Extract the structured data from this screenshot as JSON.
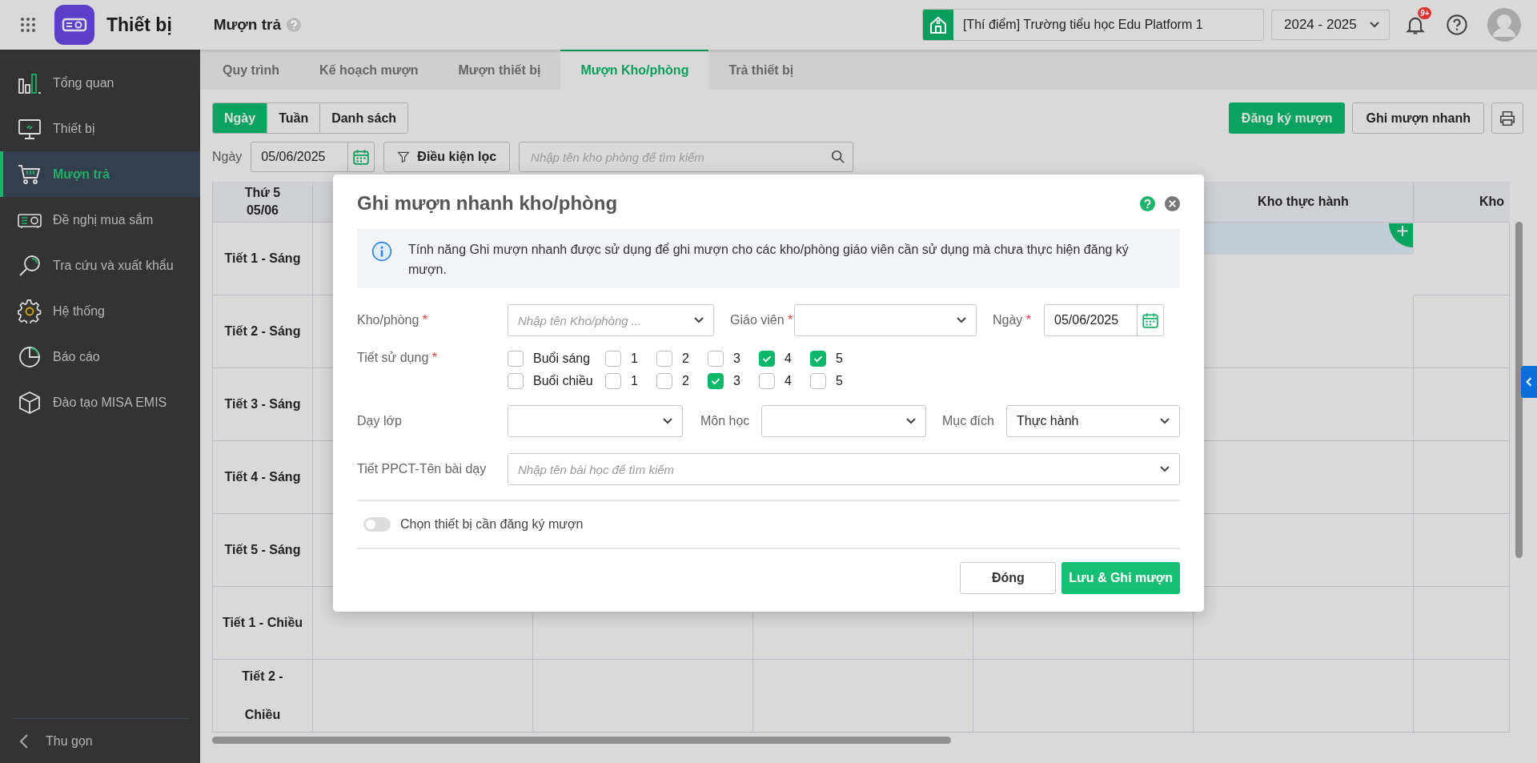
{
  "app": {
    "title": "Thiết bị",
    "page_title": "Mượn trả"
  },
  "header": {
    "school": "[Thí điểm] Trường tiểu học Edu Platform 1",
    "year": "2024 - 2025",
    "notification_badge": "9+"
  },
  "sidebar": {
    "items": [
      {
        "label": "Tổng quan",
        "selected": false
      },
      {
        "label": "Thiết bị",
        "selected": false
      },
      {
        "label": "Mượn trả",
        "selected": true
      },
      {
        "label": "Đề nghị mua sắm",
        "selected": false
      },
      {
        "label": "Tra cứu và xuất khẩu",
        "selected": false
      },
      {
        "label": "Hệ thống",
        "selected": false
      },
      {
        "label": "Báo cáo",
        "selected": false
      },
      {
        "label": "Đào tạo MISA EMIS",
        "selected": false
      }
    ],
    "collapse": "Thu gọn"
  },
  "tabs": [
    {
      "label": "Quy trình",
      "selected": false
    },
    {
      "label": "Kế hoạch mượn",
      "selected": false
    },
    {
      "label": "Mượn thiết bị",
      "selected": false
    },
    {
      "label": "Mượn Kho/phòng",
      "selected": true
    },
    {
      "label": "Trả thiết bị",
      "selected": false
    }
  ],
  "view_modes": [
    {
      "label": "Ngày",
      "selected": true
    },
    {
      "label": "Tuần",
      "selected": false
    },
    {
      "label": "Danh sách",
      "selected": false
    }
  ],
  "actions": {
    "register": "Đăng ký mượn",
    "quick": "Ghi mượn nhanh"
  },
  "filter": {
    "date_label": "Ngày",
    "date": "05/06/2025",
    "filter_button": "Điều kiện lọc",
    "search_placeholder": "Nhập tên kho phòng để tìm kiếm"
  },
  "table": {
    "day_header": "Thứ 5\n05/06",
    "columns": [
      {
        "label": "Kho thực hành"
      },
      {
        "label": "Kho"
      }
    ],
    "rows": [
      {
        "label": "Tiết 1 - Sáng",
        "cells": [
          {
            "selected": true
          },
          {
            "selected": false
          }
        ]
      },
      {
        "label": "Tiết 2 - Sáng",
        "cells": [
          {
            "selected": false
          },
          {
            "selected": false
          }
        ]
      },
      {
        "label": "Tiết 3 - Sáng",
        "cells": [
          {
            "selected": false
          },
          {
            "selected": false
          }
        ]
      },
      {
        "label": "Tiết 4 - Sáng",
        "cells": [
          {
            "selected": false
          },
          {
            "selected": false
          }
        ]
      },
      {
        "label": "Tiết 5 - Sáng",
        "cells": [
          {
            "selected": false
          },
          {
            "selected": false
          }
        ]
      },
      {
        "label": "Tiết 1 - Chiều",
        "cells": [
          {
            "selected": false
          },
          {
            "selected": false
          }
        ]
      },
      {
        "label": "Tiết 2 -\nChiều",
        "cells": [
          {
            "selected": false
          },
          {
            "selected": false
          }
        ]
      }
    ]
  },
  "dialog": {
    "title": "Ghi mượn nhanh kho/phòng",
    "info": "Tính năng Ghi mượn nhanh được sử dụng để ghi mượn cho các kho/phòng giáo viên cần sử dụng mà chưa thực hiện đăng ký mượn.",
    "room": {
      "label": "Kho/phòng",
      "mark": "*",
      "placeholder": "Nhập tên Kho/phòng ..."
    },
    "teacher": {
      "label": "Giáo viên",
      "mark": "*"
    },
    "date": {
      "label": "Ngày",
      "mark": "*",
      "value": "05/06/2025"
    },
    "periods": {
      "label": "Tiết sử dụng",
      "mark": "*",
      "sessions": [
        {
          "label": "Buổi sáng",
          "checked": false,
          "periods": [
            {
              "label": "1",
              "checked": false
            },
            {
              "label": "2",
              "checked": false
            },
            {
              "label": "3",
              "checked": false
            },
            {
              "label": "4",
              "checked": true
            },
            {
              "label": "5",
              "checked": true
            }
          ]
        },
        {
          "label": "Buổi chiều",
          "checked": false,
          "periods": [
            {
              "label": "1",
              "checked": false
            },
            {
              "label": "2",
              "checked": false
            },
            {
              "label": "3",
              "checked": true
            },
            {
              "label": "4",
              "checked": false
            },
            {
              "label": "5",
              "checked": false
            }
          ]
        }
      ]
    },
    "class": {
      "label": "Dạy lớp"
    },
    "subject": {
      "label": "Môn học"
    },
    "purpose": {
      "label": "Mục đích",
      "value": "Thực hành"
    },
    "lesson": {
      "label": "Tiết PPCT-Tên bài dạy",
      "placeholder": "Nhập tên bài học để tìm kiếm"
    },
    "device_toggle": {
      "label": "Chọn thiết bị cần đăng ký mượn",
      "on": false
    },
    "buttons": {
      "close": "Đóng",
      "save": "Lưu & Ghi mượn"
    }
  }
}
